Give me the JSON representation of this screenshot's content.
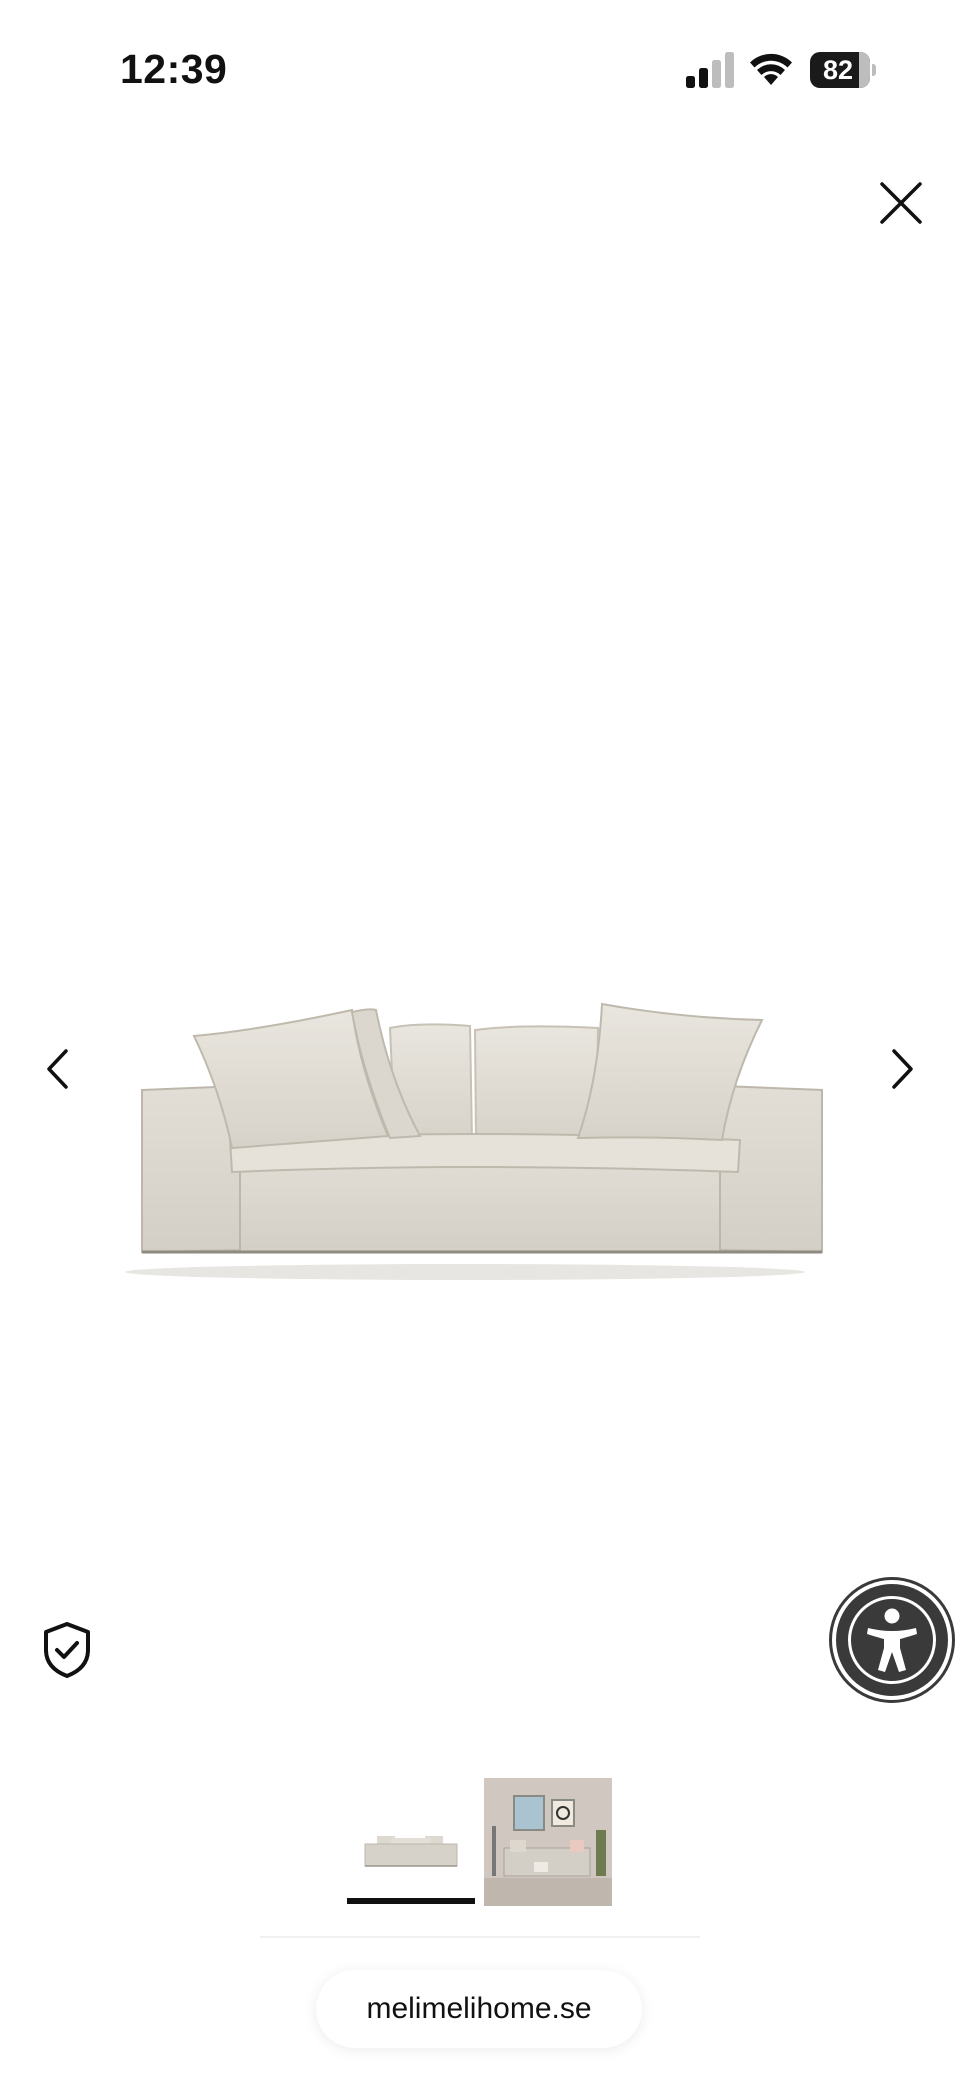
{
  "status_bar": {
    "time": "12:39",
    "battery_level": "82",
    "battery_fraction": 0.82,
    "signal_bars_active": 2,
    "signal_bars_total": 4
  },
  "icons": {
    "close": "close-icon",
    "prev": "chevron-left-icon",
    "next": "chevron-right-icon",
    "shield": "shield-check-icon",
    "accessibility": "accessibility-person-icon",
    "wifi": "wifi-icon",
    "signal": "cellular-signal-icon",
    "battery": "battery-icon"
  },
  "gallery": {
    "images": [
      "sofa-product-image",
      "sofa-living-room-image"
    ],
    "selected_index": 0
  },
  "browser": {
    "domain": "melimelihome.se"
  },
  "colors": {
    "sofa": "#dedad2",
    "accessibility_button": "#3a3a3a",
    "text": "#111111"
  }
}
